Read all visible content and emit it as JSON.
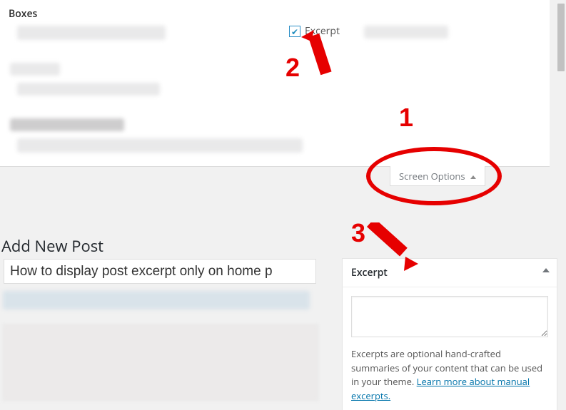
{
  "panel": {
    "heading": "Boxes",
    "excerpt_label": "Excerpt"
  },
  "tab": {
    "label": "Screen Options"
  },
  "editor": {
    "page_title": "Add New Post",
    "post_title": "How to display post excerpt only on home p"
  },
  "metabox": {
    "title": "Excerpt",
    "help_text": "Excerpts are optional hand-crafted summaries of your content that can be used in your theme. ",
    "learn_more": "Learn more about manual excerpts."
  },
  "annotations": {
    "n1": "1",
    "n2": "2",
    "n3": "3"
  }
}
